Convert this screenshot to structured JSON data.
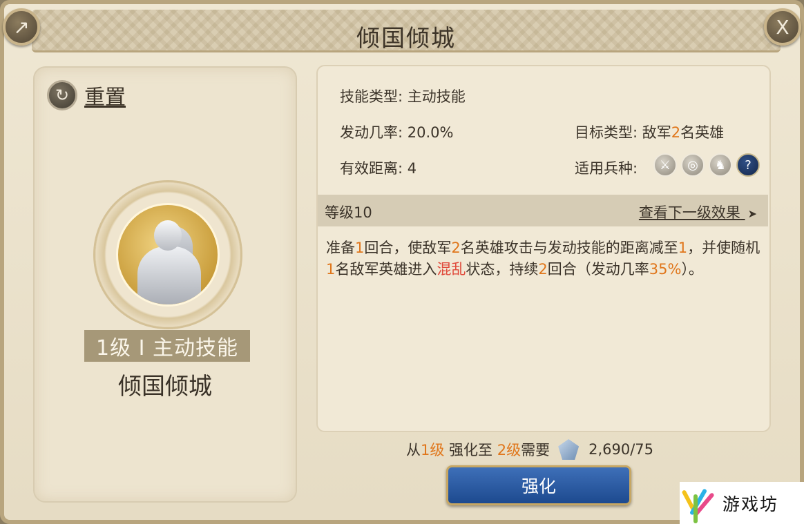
{
  "window": {
    "title": "倾国倾城",
    "share_icon": "share-icon",
    "close_icon": "close-icon",
    "close_glyph": "X"
  },
  "left": {
    "reset_label": "重置",
    "level_badge": "1级 I 主动技能",
    "skill_name": "倾国倾城"
  },
  "details": {
    "skill_type_label": "技能类型: ",
    "skill_type_value": "主动技能",
    "trigger_rate_label": "发动几率: ",
    "trigger_rate_value": "20.0%",
    "target_type_label": "目标类型: ",
    "target_type_prefix": "敌军",
    "target_type_count": "2",
    "target_type_suffix": "名英雄",
    "range_label": "有效距离: ",
    "range_value": "4",
    "troop_label": "适用兵种: ",
    "troop_icons": [
      "sword-icon",
      "bow-target-icon",
      "horse-icon",
      "question-icon"
    ],
    "troop_unknown_glyph": "?"
  },
  "level_bar": {
    "level": "等级10",
    "next_link": "查看下一级效果",
    "arrow": "➤"
  },
  "description": {
    "p1": "准备",
    "n1": "1",
    "p2": "回合，使敌军",
    "n2": "2",
    "p3": "名英雄攻击与发动技能的距离减至",
    "n3": "1",
    "p4": "，并使随机",
    "n4": "1",
    "p5": "名敌军英雄进入",
    "status": "混乱",
    "p6": "状态，持续",
    "n5": "2",
    "p7": "回合（发动几率",
    "n6": "35%",
    "p8": "）。"
  },
  "upgrade": {
    "from_prefix": "从",
    "from_level": "1级",
    "mid": " 强化至 ",
    "to_level": "2级",
    "need": "需要",
    "resource_icon": "crystal-icon",
    "cost": "2,690/75",
    "button_label": "强化"
  },
  "watermark": {
    "text": "游戏坊"
  },
  "colors": {
    "accent_orange": "#e0761b",
    "status_red": "#e0493a",
    "button_blue": "#1d4a8f"
  }
}
